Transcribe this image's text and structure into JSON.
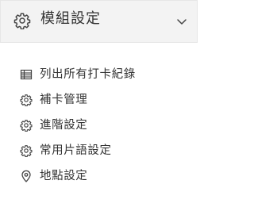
{
  "header": {
    "title": "模組設定",
    "icon": "gear-icon",
    "toggle_icon": "chevron-down-icon"
  },
  "menu": {
    "items": [
      {
        "label": "列出所有打卡紀錄",
        "icon": "table-icon"
      },
      {
        "label": "補卡管理",
        "icon": "gear-icon"
      },
      {
        "label": "進階設定",
        "icon": "gear-icon"
      },
      {
        "label": "常用片語設定",
        "icon": "gear-icon"
      },
      {
        "label": "地點設定",
        "icon": "location-pin-icon"
      }
    ]
  },
  "colors": {
    "header_bg": "#f3f3f3",
    "text": "#333333",
    "icon": "#444444"
  }
}
